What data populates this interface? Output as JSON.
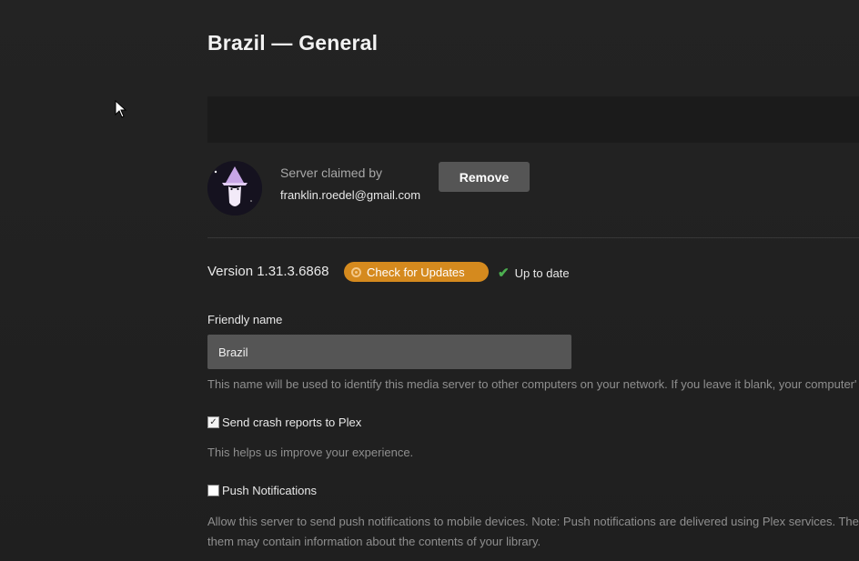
{
  "page": {
    "title": "Brazil — General"
  },
  "server": {
    "claimed_label": "Server claimed by",
    "claimed_email": "franklin.roedel@gmail.com",
    "remove_label": "Remove"
  },
  "version": {
    "text": "Version 1.31.3.6868",
    "check_updates_label": "Check for Updates",
    "status": "Up to date"
  },
  "friendly_name": {
    "label": "Friendly name",
    "value": "Brazil",
    "help": "This name will be used to identify this media server to other computers on your network. If you leave it blank, your computer'"
  },
  "crash_reports": {
    "label": "Send crash reports to Plex",
    "checked": true,
    "help": "This helps us improve your experience."
  },
  "push_notifications": {
    "label": "Push Notifications",
    "checked": false,
    "help_line1": "Allow this server to send push notifications to mobile devices. Note: Push notifications are delivered using Plex services. They'",
    "help_line2": "them may contain information about the contents of your library."
  },
  "colors": {
    "accent": "#d58a1e",
    "success": "#4caf50",
    "background": "#212121"
  }
}
